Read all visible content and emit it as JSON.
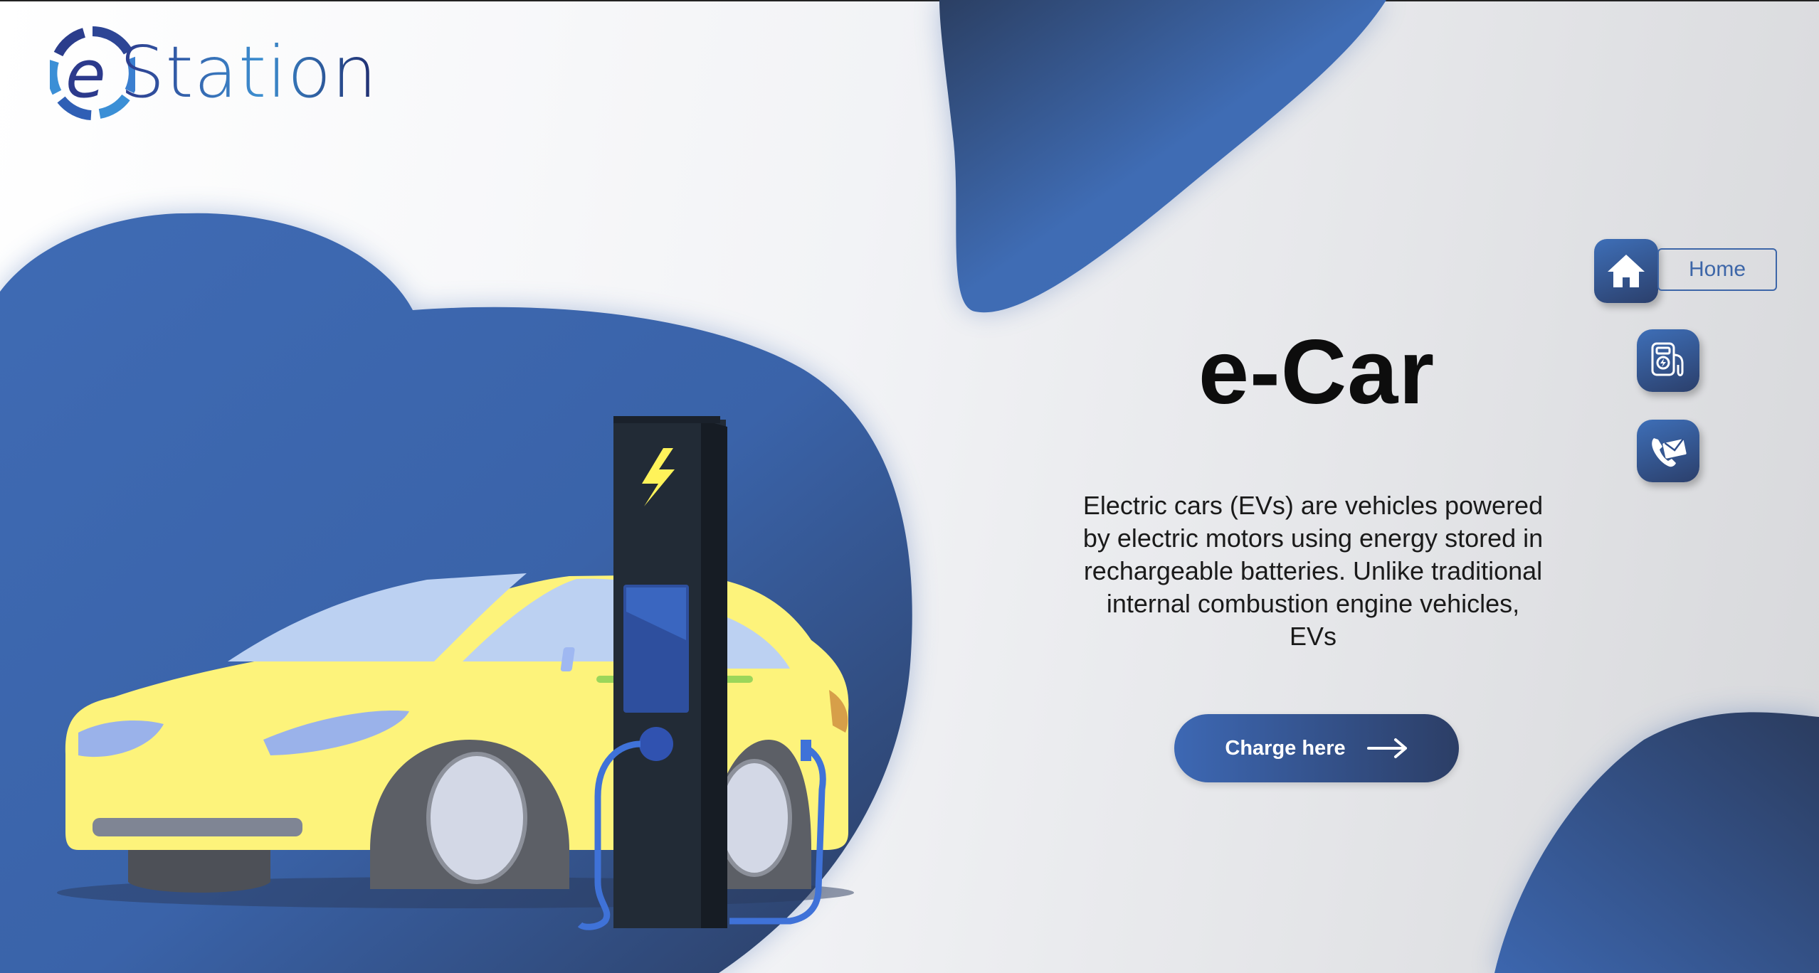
{
  "brand": {
    "name": "eStation",
    "logo_letter": "e"
  },
  "nav": {
    "home_label": "Home",
    "items": [
      {
        "icon": "home-icon"
      },
      {
        "icon": "charging-station-icon"
      },
      {
        "icon": "contact-mail-phone-icon"
      }
    ]
  },
  "hero": {
    "title": "e-Car",
    "description": "Electric cars (EVs) are vehicles powered by electric motors using energy stored in rechargeable batteries. Unlike traditional internal combustion engine vehicles, EVs",
    "cta_label": "Charge here",
    "cta_icon": "arrow-right-icon"
  },
  "colors": {
    "primary_blue": "#3d68b4",
    "dark_navy": "#2c3e66",
    "car_yellow": "#fdf37b",
    "charger_dark": "#222b36",
    "bolt_yellow": "#fff35a"
  }
}
